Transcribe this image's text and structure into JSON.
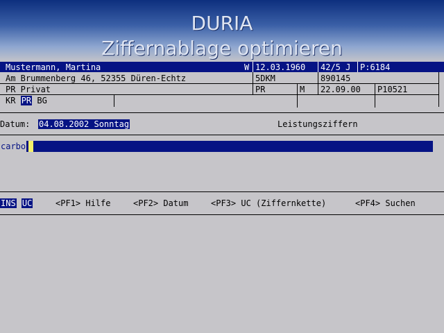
{
  "banner": {
    "title": "DURIA",
    "subtitle": "Ziffernablage optimieren"
  },
  "patient": {
    "name": "Mustermann, Martina",
    "sex": "W",
    "birthdate": "12.03.1960",
    "age": "42/5 J",
    "patient_no": "P:6184",
    "address": "Am Brummenberg 46, 52355 Düren-Echtz",
    "distance": "5DKM",
    "insurance_no": "890145",
    "insurance_type": "PR Privat",
    "ins_code": "PR",
    "member_status": "M",
    "valid_date": "22.09.00",
    "doctor_code": "P10521",
    "tags": [
      "KR",
      "PR",
      "BG"
    ]
  },
  "date_row": {
    "label": "Datum:",
    "value": "04.08.2002  Sonntag",
    "section_title": "Leistungsziffern"
  },
  "input": {
    "value": "carbo"
  },
  "footer": {
    "mode_ins": "INS",
    "mode_uc": "UC",
    "keys": [
      {
        "label": "<PF1> Hilfe"
      },
      {
        "label": "<PF2> Datum"
      },
      {
        "label": "<PF3> UC (Ziffernkette)"
      },
      {
        "label": "<PF4> Suchen"
      }
    ]
  },
  "colors": {
    "screen_bg": "#c6c5c9",
    "highlight": "#061384",
    "cursor": "#f3ef6b"
  }
}
